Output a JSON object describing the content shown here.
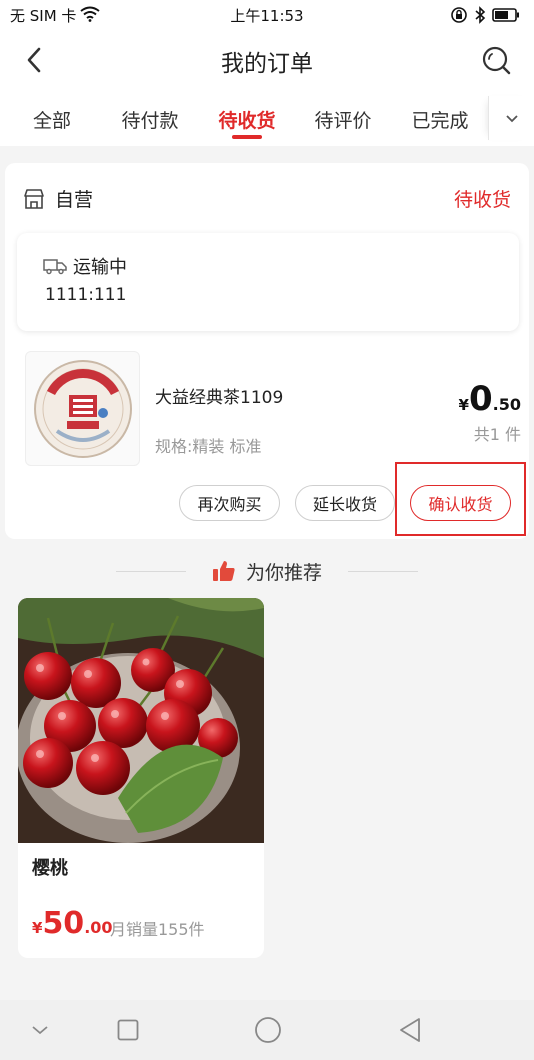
{
  "status_bar": {
    "carrier": "无 SIM 卡",
    "time": "上午11:53"
  },
  "header": {
    "title": "我的订单"
  },
  "tabs": [
    {
      "label": "全部",
      "active": false
    },
    {
      "label": "待付款",
      "active": false
    },
    {
      "label": "待收货",
      "active": true
    },
    {
      "label": "待评价",
      "active": false
    },
    {
      "label": "已完成",
      "active": false
    }
  ],
  "order": {
    "store_name": "自营",
    "status": "待收货",
    "logistics": {
      "status": "运输中",
      "tracking": "1111:111"
    },
    "product": {
      "name": "大益经典茶1109",
      "spec": "规格:精装 标准",
      "price_currency": "¥",
      "price_integer": "0",
      "price_decimal": ".50",
      "quantity": "共1 件"
    },
    "buttons": {
      "rebuy": "再次购买",
      "extend": "延长收货",
      "confirm": "确认收货"
    }
  },
  "recommend": {
    "title": "为你推荐",
    "items": [
      {
        "name": "樱桃",
        "price_currency": "¥",
        "price_integer": "50",
        "price_decimal": ".00",
        "sales": "月销量155件"
      }
    ]
  },
  "colors": {
    "accent": "#e02a2a",
    "muted_text": "#999999",
    "background": "#f4f4f4"
  },
  "icons": {
    "status_bar": [
      "wifi-icon",
      "lock-rotation-icon",
      "bluetooth-icon",
      "battery-icon"
    ],
    "header": [
      "back-arrow-icon",
      "search-icon"
    ],
    "tabs_more": "chevron-down-icon",
    "store": "store-icon",
    "logistics": "truck-icon",
    "recommend": "thumbs-up-icon",
    "navbar": [
      "nav-collapse-icon",
      "nav-recents-icon",
      "nav-home-icon",
      "nav-back-icon"
    ]
  }
}
